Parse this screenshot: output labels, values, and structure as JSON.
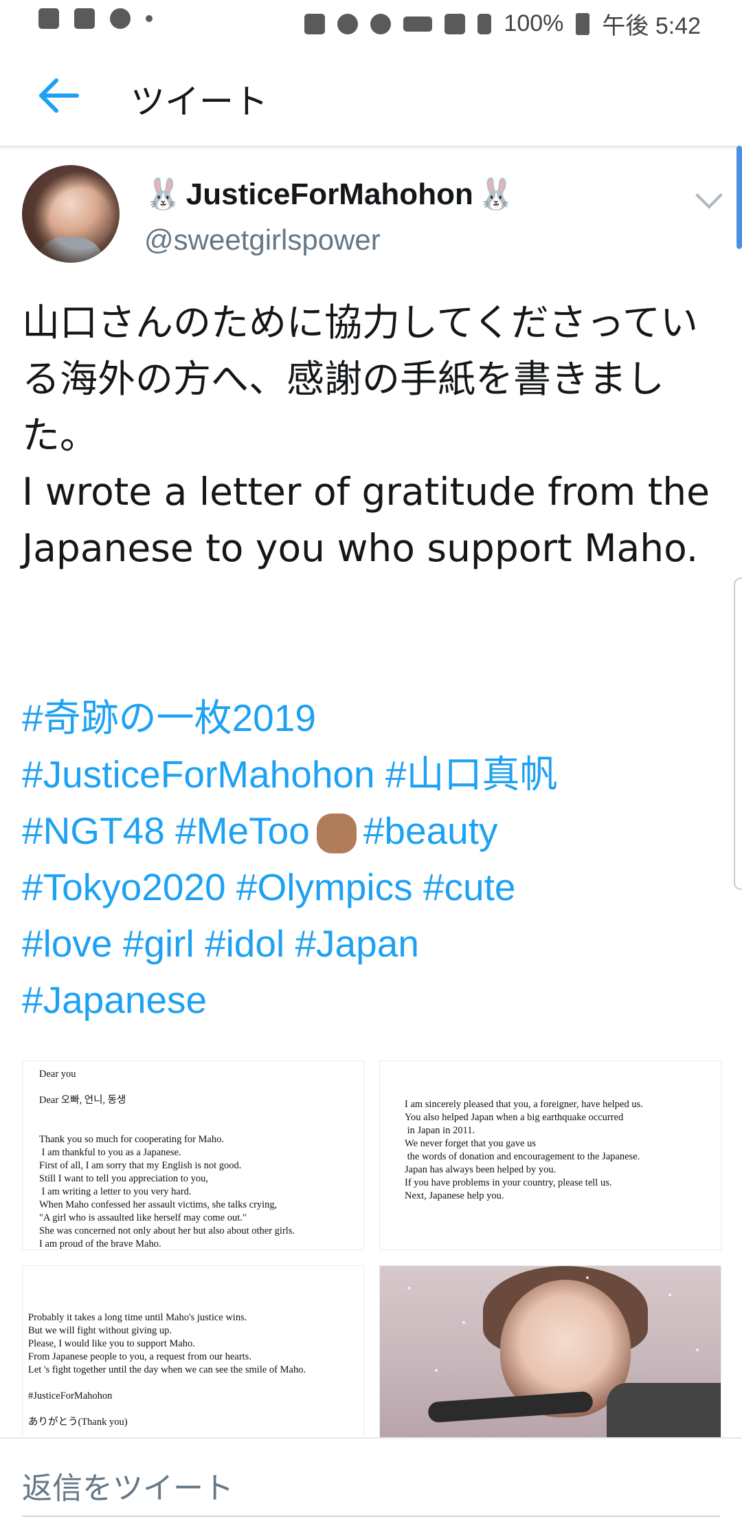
{
  "status_bar": {
    "battery": "100%",
    "time": "午後 5:42",
    "icons": [
      "broom-icon",
      "shield-icon",
      "wifi-call-icon",
      "dot-icon",
      "recycle-icon",
      "location-icon",
      "alarm-icon",
      "volte-icon",
      "wifi-icon",
      "signal-icon",
      "battery-icon"
    ]
  },
  "header": {
    "title": "ツイート",
    "back_icon": "back-arrow-icon"
  },
  "tweet": {
    "display_name": "JusticeForMahohon",
    "name_emoji": "🐰",
    "handle": "@sweetgirlspower",
    "text_jp": "山口さんのために協力してくださっている海外の方へ、感謝の手紙を書きました。",
    "text_en": "I wrote a letter of gratitude from the Japanese to you who support Maho.",
    "hashtags_line1": "#奇跡の一枚2019",
    "hashtags_line2": "#JusticeForMahohon #山口真帆",
    "hashtags_line3a": "#NGT48 #MeToo",
    "hashtags_line3b": "#beauty",
    "hashtags_line4": "#Tokyo2020 #Olympics #cute",
    "hashtags_line5": "#love #girl #idol #Japan",
    "hashtags_line6": "#Japanese",
    "link_color": "#1da1f2"
  },
  "images": {
    "letter1": "Dear you\n\nDear 오빠, 언니, 동생\n\n\nThank you so much for cooperating for Maho.\n I am thankful to you as a Japanese.\nFirst of all, I am sorry that my English is not good.\nStill I want to tell you appreciation to you,\n I am writing a letter to you very hard.\nWhen Maho confessed her assault victims, she talks crying,\n\"A girl who is assaulted like herself may come out.\"\nShe was concerned not only about her but also about other girls.\nI am proud of the brave Maho.",
    "letter2": "I am sincerely pleased that you, a foreigner, have helped us.\nYou also helped Japan when a big earthquake occurred\n in Japan in 2011.\nWe never forget that you gave us\n the words of donation and encouragement to the Japanese.\nJapan has always been helped by you.\nIf you have problems in your country, please tell us.\nNext, Japanese help you.",
    "letter3": "Probably it takes a long time until Maho's justice wins.\nBut we will fight without giving up.\nPlease, I would like you to support Maho.\nFrom Japanese people to you, a request from our hearts.\nLet 's fight together until the day when we can see the smile of Maho.\n\n#JusticeForMahohon\n\nありがとう(Thank you)"
  },
  "reply": {
    "placeholder": "返信をツイート"
  }
}
